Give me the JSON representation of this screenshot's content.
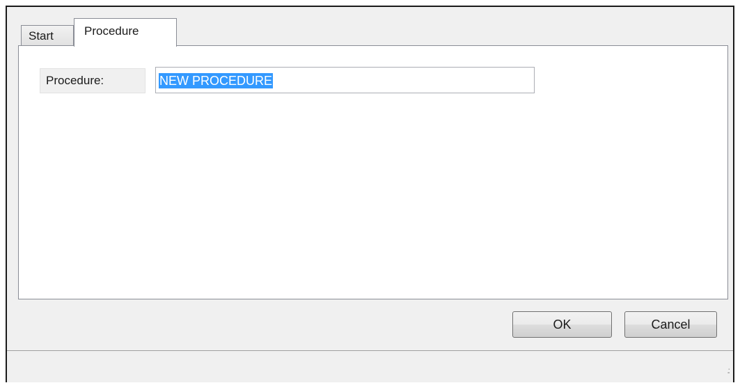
{
  "tabs": [
    {
      "label": "Start",
      "active": false
    },
    {
      "label": "Procedure",
      "active": true
    }
  ],
  "form": {
    "procedure_label": "Procedure:",
    "procedure_value": "NEW PROCEDURE"
  },
  "buttons": {
    "ok_label": "OK",
    "cancel_label": "Cancel"
  },
  "colors": {
    "selection": "#3399ff",
    "window_bg": "#f0f0f0"
  }
}
